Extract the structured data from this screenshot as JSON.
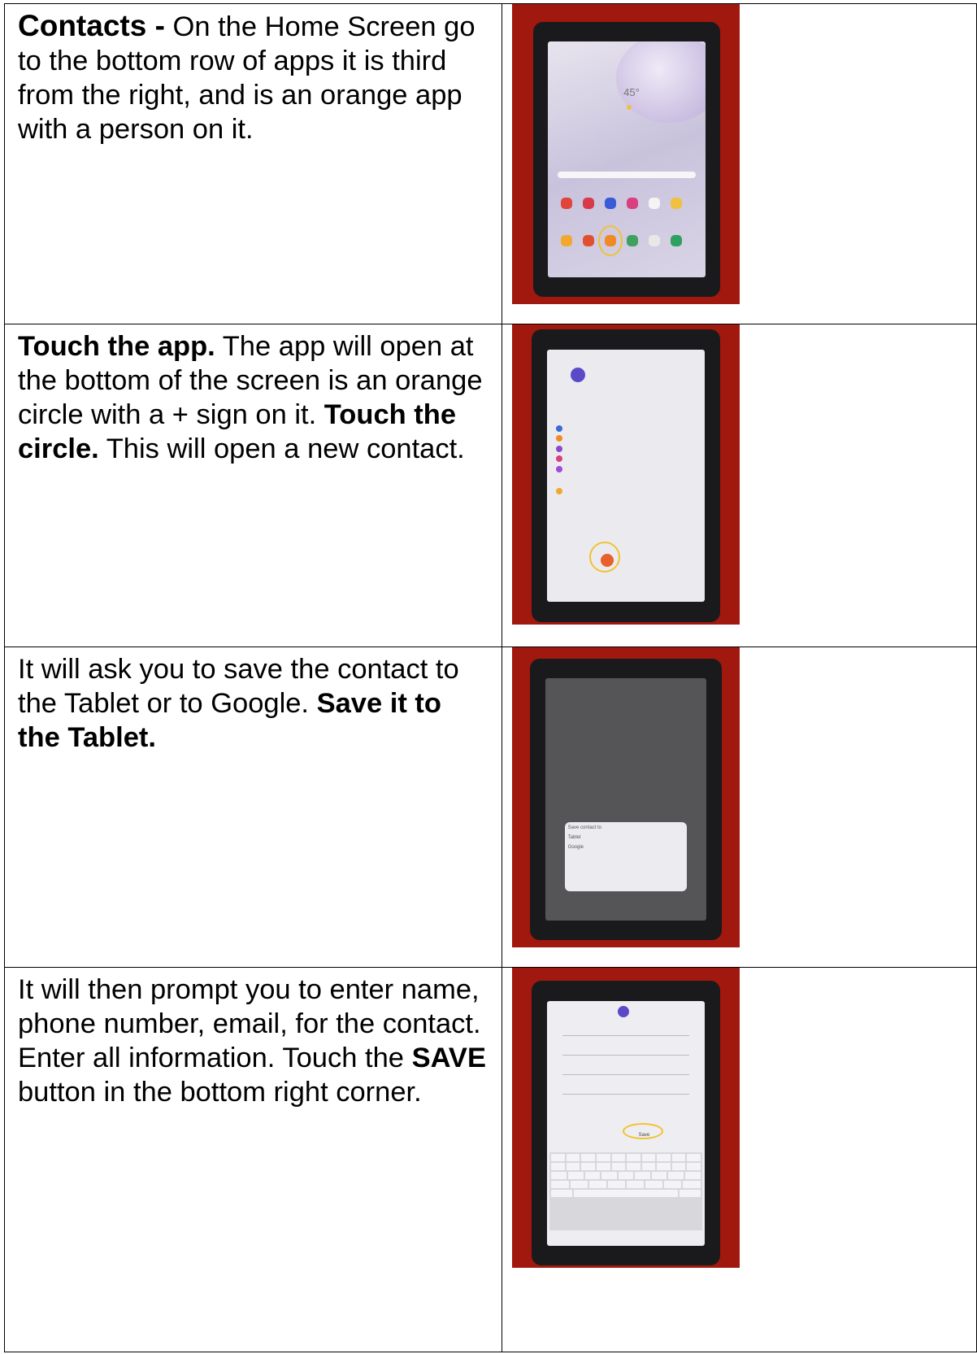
{
  "rows": [
    {
      "bold_lead": "Contacts -",
      "text_1": " On the Home Screen go to the bottom row of apps it is third from the right, and is an orange app with a person on it.",
      "photo": {
        "description_label": "tablet-home-screen-photo",
        "weather_temp": "45°"
      }
    },
    {
      "bold_lead": "Touch the app.",
      "text_1": " The app will open at the bottom of the screen is an orange circle with a + sign on it. ",
      "bold_mid": "Touch the circle.",
      "text_2": " This will open a new contact.",
      "photo": {
        "description_label": "contacts-app-photo"
      }
    },
    {
      "text_1": "It will ask you to save the contact to the Tablet or to Google. ",
      "bold_mid": "Save it to the Tablet.",
      "photo": {
        "description_label": "save-contact-dialog-photo",
        "dialog_title": "Save contact to",
        "option_1": "Tablet",
        "option_2": "Google"
      }
    },
    {
      "text_1": "It will then prompt you to enter name, phone number, email, for the contact. Enter all information. Touch the ",
      "bold_mid": "SAVE",
      "text_2": " button in the bottom right corner.",
      "photo": {
        "description_label": "new-contact-form-photo",
        "save_label": "Save"
      }
    }
  ],
  "colors": {
    "background_red": "#a0180e",
    "highlight_yellow": "#f1c232",
    "contacts_orange": "#f08a24"
  }
}
